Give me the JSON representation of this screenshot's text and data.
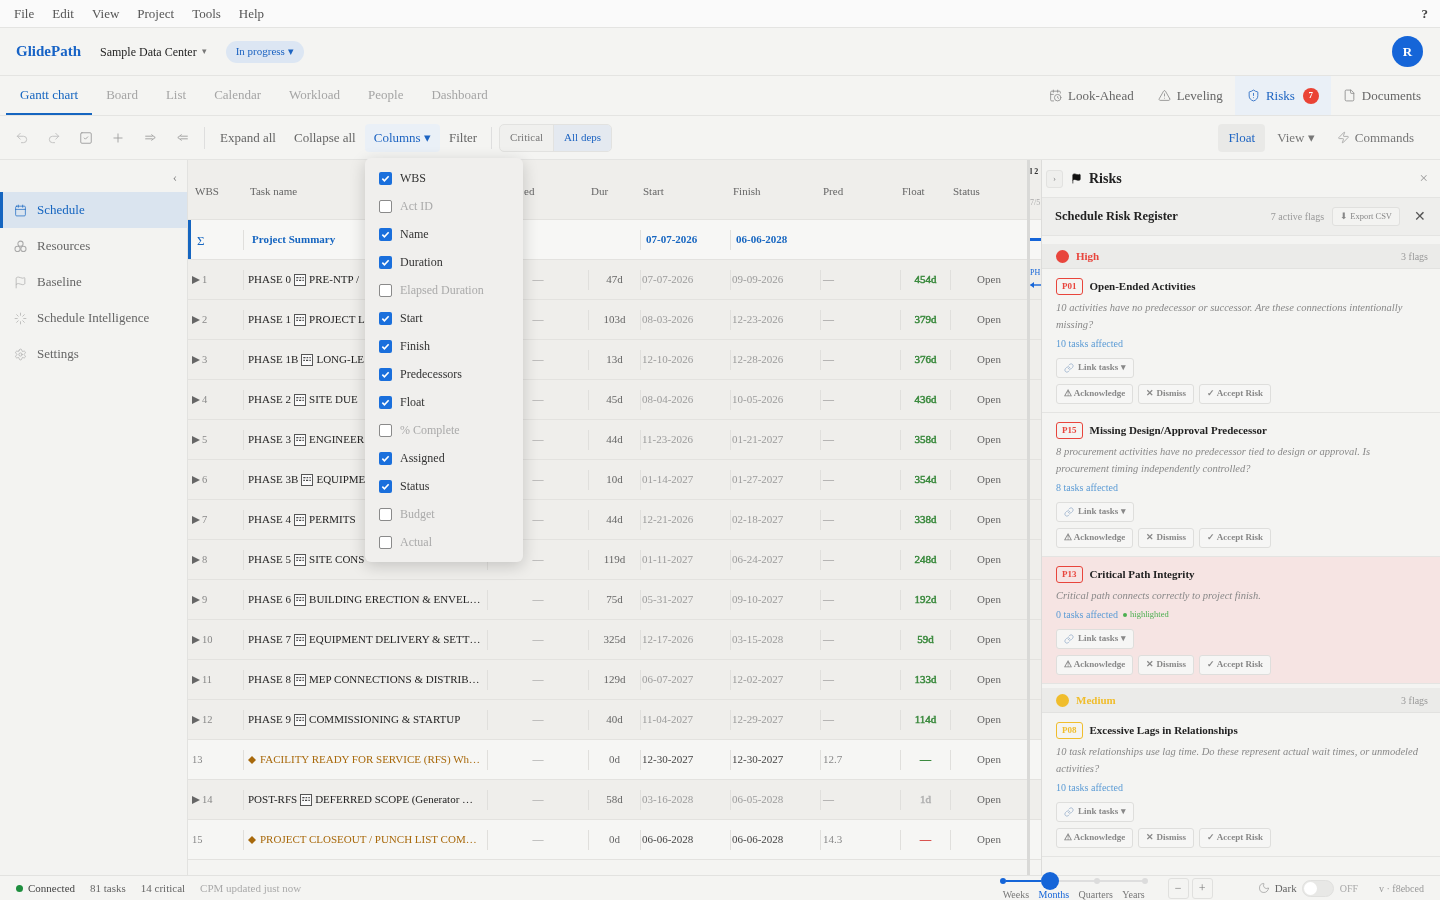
{
  "menu_bar": {
    "items": [
      "File",
      "Edit",
      "View",
      "Project",
      "Tools",
      "Help"
    ],
    "help": "?"
  },
  "header": {
    "brand": "GlidePath",
    "project": "Sample Data Center",
    "project_caret": "▾",
    "status": "In progress ▾",
    "avatar": "R"
  },
  "view_tabs": [
    {
      "label": "Gantt chart",
      "selected": true
    },
    {
      "label": "Board",
      "selected": false
    },
    {
      "label": "List",
      "selected": false
    },
    {
      "label": "Calendar",
      "selected": false
    },
    {
      "label": "Workload",
      "selected": false
    },
    {
      "label": "People",
      "selected": false
    },
    {
      "label": "Dashboard",
      "selected": false
    }
  ],
  "panel_tabs": [
    {
      "label": "Look-Ahead",
      "selected": false
    },
    {
      "label": "Leveling",
      "selected": false
    },
    {
      "label": "Risks",
      "selected": true,
      "badge": "7"
    },
    {
      "label": "Documents",
      "selected": false
    }
  ],
  "toolbar": {
    "actions": [
      {
        "label": "Expand all",
        "active": false
      },
      {
        "label": "Collapse all",
        "active": false
      },
      {
        "label": "Columns ▾",
        "active": true
      },
      {
        "label": "Filter",
        "active": false
      }
    ],
    "dependency_filter": [
      {
        "label": "Critical",
        "selected": false
      },
      {
        "label": "All deps",
        "selected": true
      }
    ],
    "right_actions": [
      {
        "kind": "toggle",
        "label": "Float",
        "active": true
      },
      {
        "kind": "menu",
        "label": "View ▾",
        "active": false
      },
      {
        "kind": "command",
        "label": "Commands",
        "active": false
      }
    ]
  },
  "sidebar": {
    "collapse": "‹",
    "items": [
      {
        "label": "Schedule",
        "selected": true
      },
      {
        "label": "Resources",
        "selected": false
      },
      {
        "label": "Baseline",
        "selected": false
      },
      {
        "label": "Schedule Intelligence",
        "selected": false
      },
      {
        "label": "Settings",
        "selected": false
      }
    ]
  },
  "table": {
    "columns": [
      "WBS",
      "Task name",
      "ed",
      "Dur",
      "Start",
      "Finish",
      "Pred",
      "Float",
      "Status"
    ],
    "summary": {
      "symbol": "Σ",
      "name": "Project Summary",
      "start": "07-07-2026",
      "finish": "06-06-2028"
    },
    "rows": [
      {
        "kind": "phase",
        "expanded": false,
        "wbs": "1",
        "phase": "PHASE 0",
        "name": "PRE-NTP /",
        "assigned": "—",
        "dur": "47d",
        "start": "07-07-2026",
        "finish": "09-09-2026",
        "pred": "—",
        "float": {
          "text": "454d",
          "color": "#3b8a3e"
        },
        "status": "Open"
      },
      {
        "kind": "phase",
        "expanded": false,
        "wbs": "2",
        "phase": "PHASE 1",
        "name": "PROJECT L",
        "assigned": "—",
        "dur": "103d",
        "start": "08-03-2026",
        "finish": "12-23-2026",
        "pred": "—",
        "float": {
          "text": "379d",
          "color": "#3b8a3e"
        },
        "status": "Open"
      },
      {
        "kind": "phase",
        "expanded": false,
        "wbs": "3",
        "phase": "PHASE 1B",
        "name": "LONG-LE",
        "assigned": "—",
        "dur": "13d",
        "start": "12-10-2026",
        "finish": "12-28-2026",
        "pred": "—",
        "float": {
          "text": "376d",
          "color": "#3b8a3e"
        },
        "status": "Open"
      },
      {
        "kind": "phase",
        "expanded": false,
        "wbs": "4",
        "phase": "PHASE 2",
        "name": "SITE DUE",
        "assigned": "—",
        "dur": "45d",
        "start": "08-04-2026",
        "finish": "10-05-2026",
        "pred": "—",
        "float": {
          "text": "436d",
          "color": "#3b8a3e"
        },
        "status": "Open"
      },
      {
        "kind": "phase",
        "expanded": false,
        "wbs": "5",
        "phase": "PHASE 3",
        "name": "ENGINEER",
        "assigned": "—",
        "dur": "44d",
        "start": "11-23-2026",
        "finish": "01-21-2027",
        "pred": "—",
        "float": {
          "text": "358d",
          "color": "#3b8a3e"
        },
        "status": "Open"
      },
      {
        "kind": "phase",
        "expanded": false,
        "wbs": "6",
        "phase": "PHASE 3B",
        "name": "EQUIPME",
        "assigned": "—",
        "dur": "10d",
        "start": "01-14-2027",
        "finish": "01-27-2027",
        "pred": "—",
        "float": {
          "text": "354d",
          "color": "#3b8a3e"
        },
        "status": "Open"
      },
      {
        "kind": "phase",
        "expanded": false,
        "wbs": "7",
        "phase": "PHASE 4",
        "name": "PERMITS",
        "assigned": "—",
        "dur": "44d",
        "start": "12-21-2026",
        "finish": "02-18-2027",
        "pred": "—",
        "float": {
          "text": "338d",
          "color": "#3b8a3e"
        },
        "status": "Open"
      },
      {
        "kind": "phase",
        "expanded": false,
        "wbs": "8",
        "phase": "PHASE 5",
        "name": "SITE CONS",
        "assigned": "—",
        "dur": "119d",
        "start": "01-11-2027",
        "finish": "06-24-2027",
        "pred": "—",
        "float": {
          "text": "248d",
          "color": "#3b8a3e"
        },
        "status": "Open"
      },
      {
        "kind": "phase",
        "expanded": false,
        "wbs": "9",
        "phase": "PHASE 6",
        "name": "BUILDING ERECTION & ENVEL…",
        "assigned": "—",
        "dur": "75d",
        "start": "05-31-2027",
        "finish": "09-10-2027",
        "pred": "—",
        "float": {
          "text": "192d",
          "color": "#3b8a3e"
        },
        "status": "Open"
      },
      {
        "kind": "phase",
        "expanded": false,
        "wbs": "10",
        "phase": "PHASE 7",
        "name": "EQUIPMENT DELIVERY & SETT…",
        "assigned": "—",
        "dur": "325d",
        "start": "12-17-2026",
        "finish": "03-15-2028",
        "pred": "—",
        "float": {
          "text": "59d",
          "color": "#3b8a3e"
        },
        "status": "Open"
      },
      {
        "kind": "phase",
        "expanded": false,
        "wbs": "11",
        "phase": "PHASE 8",
        "name": "MEP CONNECTIONS & DISTRIB…",
        "assigned": "—",
        "dur": "129d",
        "start": "06-07-2027",
        "finish": "12-02-2027",
        "pred": "—",
        "float": {
          "text": "133d",
          "color": "#3b8a3e"
        },
        "status": "Open"
      },
      {
        "kind": "phase",
        "expanded": false,
        "wbs": "12",
        "phase": "PHASE 9",
        "name": "COMMISSIONING & STARTUP",
        "assigned": "—",
        "dur": "40d",
        "start": "11-04-2027",
        "finish": "12-29-2027",
        "pred": "—",
        "float": {
          "text": "114d",
          "color": "#3b8a3e"
        },
        "status": "Open"
      },
      {
        "kind": "milestone",
        "wbs": "13",
        "name": "FACILITY READY FOR SERVICE (RFS) Wh…",
        "assigned": "—",
        "dur": "0d",
        "start": "12-30-2027",
        "finish": "12-30-2027",
        "pred": "12.7",
        "float": {
          "text": "—",
          "color": "#3b8a3e"
        },
        "status": "Open"
      },
      {
        "kind": "phase",
        "expanded": false,
        "wbs": "14",
        "phase": "POST-RFS",
        "name": "DEFERRED SCOPE (Generator …",
        "assigned": "—",
        "dur": "58d",
        "start": "03-16-2028",
        "finish": "06-05-2028",
        "pred": "—",
        "float": {
          "text": "1d",
          "color": "#b0b0b0"
        },
        "status": "Open"
      },
      {
        "kind": "milestone",
        "wbs": "15",
        "name": "PROJECT CLOSEOUT / PUNCH LIST COM…",
        "assigned": "—",
        "dur": "0d",
        "start": "06-06-2028",
        "finish": "06-06-2028",
        "pred": "14.3",
        "float": {
          "text": "—",
          "color": "#d9534f"
        },
        "status": "Open"
      }
    ]
  },
  "gantt": {
    "month": "l 2",
    "day": "7/5",
    "bar_label": "PH"
  },
  "columns_menu": {
    "items": [
      {
        "label": "WBS",
        "checked": true
      },
      {
        "label": "Act ID",
        "checked": false
      },
      {
        "label": "Name",
        "checked": true
      },
      {
        "label": "Duration",
        "checked": true
      },
      {
        "label": "Elapsed Duration",
        "checked": false
      },
      {
        "label": "Start",
        "checked": true
      },
      {
        "label": "Finish",
        "checked": true
      },
      {
        "label": "Predecessors",
        "checked": true
      },
      {
        "label": "Float",
        "checked": true
      },
      {
        "label": "% Complete",
        "checked": false
      },
      {
        "label": "Assigned",
        "checked": true
      },
      {
        "label": "Status",
        "checked": true
      },
      {
        "label": "Budget",
        "checked": false
      },
      {
        "label": "Actual",
        "checked": false
      }
    ]
  },
  "risk_panel": {
    "collapse": "›",
    "title": "Risks",
    "close": "×",
    "register": {
      "title": "Schedule Risk Register",
      "count": "7 active flags",
      "export": "⬇ Export CSV",
      "close": "✕"
    },
    "groups": [
      {
        "level": "High",
        "color": "#e8453c",
        "count": "3 flags",
        "items": [
          {
            "code": "P01",
            "title": "Open-Ended Activities",
            "description": "10 activities have no predecessor or successor. Are these connections intentionally missing?",
            "affected": "10 tasks affected",
            "highlighted": false,
            "link": "Link tasks ▾",
            "actions": [
              "⚠ Acknowledge",
              "✕ Dismiss",
              "✓ Accept Risk"
            ]
          },
          {
            "code": "P15",
            "title": "Missing Design/Approval Predecessor",
            "description": "8 procurement activities have no predecessor tied to design or approval. Is procurement timing independently controlled?",
            "affected": "8 tasks affected",
            "highlighted": false,
            "link": "Link tasks ▾",
            "actions": [
              "⚠ Acknowledge",
              "✕ Dismiss",
              "✓ Accept Risk"
            ]
          },
          {
            "code": "P13",
            "title": "Critical Path Integrity",
            "description": "Critical path connects correctly to project finish.",
            "affected": "0 tasks affected",
            "highlighted": true,
            "highlight_label": "highlighted",
            "link": "Link tasks ▾",
            "actions": [
              "⚠ Acknowledge",
              "✕ Dismiss",
              "✓ Accept Risk"
            ]
          }
        ]
      },
      {
        "level": "Medium",
        "color": "#f0bd2c",
        "count": "3 flags",
        "items": [
          {
            "code": "P08",
            "title": "Excessive Lags in Relationships",
            "description": "10 task relationships use lag time. Do these represent actual wait times, or unmodeled activities?",
            "affected": "10 tasks affected",
            "highlighted": false,
            "link": "Link tasks ▾",
            "actions": [
              "⚠ Acknowledge",
              "✕ Dismiss",
              "✓ Accept Risk"
            ]
          }
        ]
      }
    ]
  },
  "status_bar": {
    "connection": {
      "label": "Connected",
      "connected": true
    },
    "stats": [
      "81 tasks",
      "14 critical"
    ],
    "updated": "CPM updated just now",
    "zoom_levels": [
      {
        "label": "Weeks",
        "selected": false
      },
      {
        "label": "Months",
        "selected": true
      },
      {
        "label": "Quarters",
        "selected": false
      },
      {
        "label": "Years",
        "selected": false
      }
    ],
    "zoom_out": "−",
    "zoom_in": "+",
    "dark_mode": {
      "label": "Dark",
      "on": false,
      "state": "OFF"
    },
    "version": "v · f8ebced"
  }
}
